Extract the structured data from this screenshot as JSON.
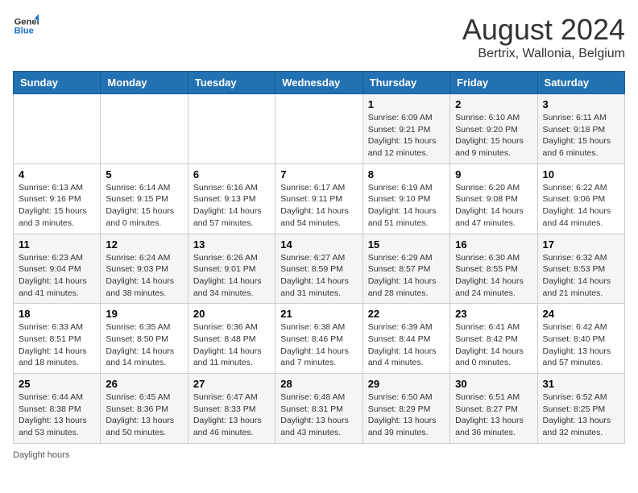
{
  "header": {
    "logo_line1": "General",
    "logo_line2": "Blue",
    "main_title": "August 2024",
    "subtitle": "Bertrix, Wallonia, Belgium"
  },
  "days_of_week": [
    "Sunday",
    "Monday",
    "Tuesday",
    "Wednesday",
    "Thursday",
    "Friday",
    "Saturday"
  ],
  "weeks": [
    [
      {
        "day": "",
        "info": ""
      },
      {
        "day": "",
        "info": ""
      },
      {
        "day": "",
        "info": ""
      },
      {
        "day": "",
        "info": ""
      },
      {
        "day": "1",
        "info": "Sunrise: 6:09 AM\nSunset: 9:21 PM\nDaylight: 15 hours and 12 minutes."
      },
      {
        "day": "2",
        "info": "Sunrise: 6:10 AM\nSunset: 9:20 PM\nDaylight: 15 hours and 9 minutes."
      },
      {
        "day": "3",
        "info": "Sunrise: 6:11 AM\nSunset: 9:18 PM\nDaylight: 15 hours and 6 minutes."
      }
    ],
    [
      {
        "day": "4",
        "info": "Sunrise: 6:13 AM\nSunset: 9:16 PM\nDaylight: 15 hours and 3 minutes."
      },
      {
        "day": "5",
        "info": "Sunrise: 6:14 AM\nSunset: 9:15 PM\nDaylight: 15 hours and 0 minutes."
      },
      {
        "day": "6",
        "info": "Sunrise: 6:16 AM\nSunset: 9:13 PM\nDaylight: 14 hours and 57 minutes."
      },
      {
        "day": "7",
        "info": "Sunrise: 6:17 AM\nSunset: 9:11 PM\nDaylight: 14 hours and 54 minutes."
      },
      {
        "day": "8",
        "info": "Sunrise: 6:19 AM\nSunset: 9:10 PM\nDaylight: 14 hours and 51 minutes."
      },
      {
        "day": "9",
        "info": "Sunrise: 6:20 AM\nSunset: 9:08 PM\nDaylight: 14 hours and 47 minutes."
      },
      {
        "day": "10",
        "info": "Sunrise: 6:22 AM\nSunset: 9:06 PM\nDaylight: 14 hours and 44 minutes."
      }
    ],
    [
      {
        "day": "11",
        "info": "Sunrise: 6:23 AM\nSunset: 9:04 PM\nDaylight: 14 hours and 41 minutes."
      },
      {
        "day": "12",
        "info": "Sunrise: 6:24 AM\nSunset: 9:03 PM\nDaylight: 14 hours and 38 minutes."
      },
      {
        "day": "13",
        "info": "Sunrise: 6:26 AM\nSunset: 9:01 PM\nDaylight: 14 hours and 34 minutes."
      },
      {
        "day": "14",
        "info": "Sunrise: 6:27 AM\nSunset: 8:59 PM\nDaylight: 14 hours and 31 minutes."
      },
      {
        "day": "15",
        "info": "Sunrise: 6:29 AM\nSunset: 8:57 PM\nDaylight: 14 hours and 28 minutes."
      },
      {
        "day": "16",
        "info": "Sunrise: 6:30 AM\nSunset: 8:55 PM\nDaylight: 14 hours and 24 minutes."
      },
      {
        "day": "17",
        "info": "Sunrise: 6:32 AM\nSunset: 8:53 PM\nDaylight: 14 hours and 21 minutes."
      }
    ],
    [
      {
        "day": "18",
        "info": "Sunrise: 6:33 AM\nSunset: 8:51 PM\nDaylight: 14 hours and 18 minutes."
      },
      {
        "day": "19",
        "info": "Sunrise: 6:35 AM\nSunset: 8:50 PM\nDaylight: 14 hours and 14 minutes."
      },
      {
        "day": "20",
        "info": "Sunrise: 6:36 AM\nSunset: 8:48 PM\nDaylight: 14 hours and 11 minutes."
      },
      {
        "day": "21",
        "info": "Sunrise: 6:38 AM\nSunset: 8:46 PM\nDaylight: 14 hours and 7 minutes."
      },
      {
        "day": "22",
        "info": "Sunrise: 6:39 AM\nSunset: 8:44 PM\nDaylight: 14 hours and 4 minutes."
      },
      {
        "day": "23",
        "info": "Sunrise: 6:41 AM\nSunset: 8:42 PM\nDaylight: 14 hours and 0 minutes."
      },
      {
        "day": "24",
        "info": "Sunrise: 6:42 AM\nSunset: 8:40 PM\nDaylight: 13 hours and 57 minutes."
      }
    ],
    [
      {
        "day": "25",
        "info": "Sunrise: 6:44 AM\nSunset: 8:38 PM\nDaylight: 13 hours and 53 minutes."
      },
      {
        "day": "26",
        "info": "Sunrise: 6:45 AM\nSunset: 8:36 PM\nDaylight: 13 hours and 50 minutes."
      },
      {
        "day": "27",
        "info": "Sunrise: 6:47 AM\nSunset: 8:33 PM\nDaylight: 13 hours and 46 minutes."
      },
      {
        "day": "28",
        "info": "Sunrise: 6:48 AM\nSunset: 8:31 PM\nDaylight: 13 hours and 43 minutes."
      },
      {
        "day": "29",
        "info": "Sunrise: 6:50 AM\nSunset: 8:29 PM\nDaylight: 13 hours and 39 minutes."
      },
      {
        "day": "30",
        "info": "Sunrise: 6:51 AM\nSunset: 8:27 PM\nDaylight: 13 hours and 36 minutes."
      },
      {
        "day": "31",
        "info": "Sunrise: 6:52 AM\nSunset: 8:25 PM\nDaylight: 13 hours and 32 minutes."
      }
    ]
  ],
  "footer": {
    "daylight_label": "Daylight hours"
  }
}
